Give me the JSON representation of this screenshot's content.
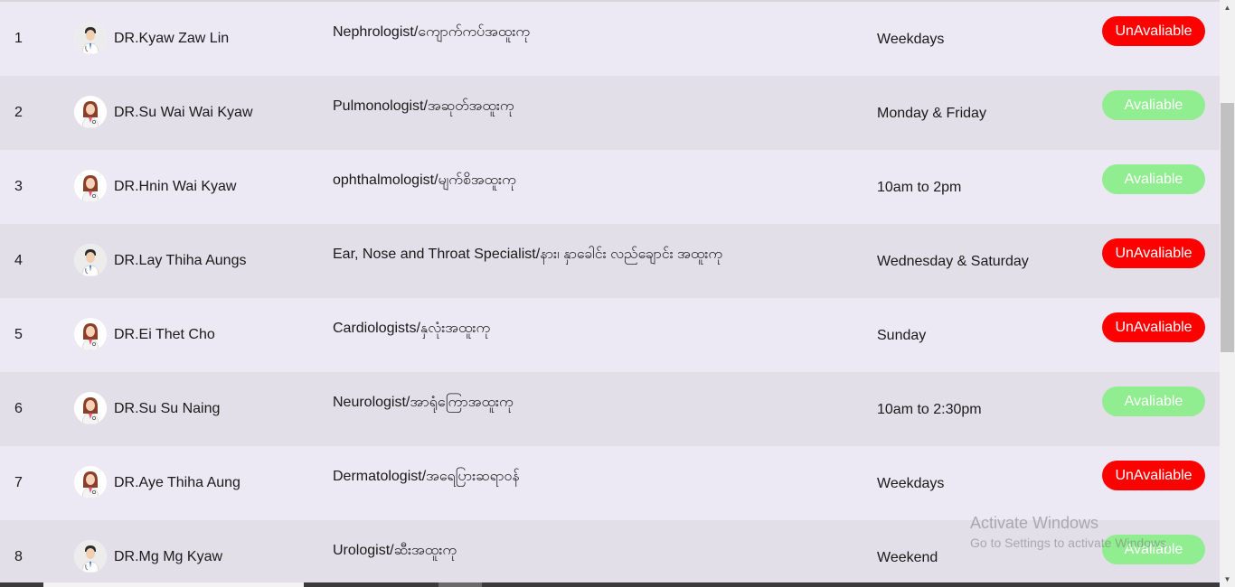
{
  "doctors": [
    {
      "number": "1",
      "name": "DR.Kyaw Zaw Lin",
      "gender": "male",
      "specialty": "Nephrologist/ကျောက်ကပ်အထူးကု",
      "schedule": "Weekdays",
      "status": "UnAvaliable",
      "status_type": "unavailable"
    },
    {
      "number": "2",
      "name": "DR.Su Wai Wai Kyaw",
      "gender": "female",
      "specialty": "Pulmonologist/အဆုတ်အထူးကု",
      "schedule": "Monday & Friday",
      "status": "Avaliable",
      "status_type": "available"
    },
    {
      "number": "3",
      "name": "DR.Hnin Wai Kyaw",
      "gender": "female",
      "specialty": "ophthalmologist/မျက်စိအထူးကု",
      "schedule": "10am to 2pm",
      "status": "Avaliable",
      "status_type": "available"
    },
    {
      "number": "4",
      "name": "DR.Lay Thiha Aungs",
      "gender": "male",
      "specialty": "Ear, Nose and Throat Specialist/နား၊ နှာခေါင်း လည်ချောင်း အထူးကု",
      "schedule": "Wednesday & Saturday",
      "status": "UnAvaliable",
      "status_type": "unavailable"
    },
    {
      "number": "5",
      "name": "DR.Ei Thet Cho",
      "gender": "female",
      "specialty": "Cardiologists/နှလုံးအထူးကု",
      "schedule": "Sunday",
      "status": "UnAvaliable",
      "status_type": "unavailable"
    },
    {
      "number": "6",
      "name": "DR.Su Su Naing",
      "gender": "female",
      "specialty": "Neurologist/အာရုံကြောအထူးကု",
      "schedule": "10am to 2:30pm",
      "status": "Avaliable",
      "status_type": "available"
    },
    {
      "number": "7",
      "name": "DR.Aye Thiha Aung",
      "gender": "female",
      "specialty": "Dermatologist/အရေပြားဆရာဝန်",
      "schedule": "Weekdays",
      "status": "UnAvaliable",
      "status_type": "unavailable"
    },
    {
      "number": "8",
      "name": "DR.Mg Mg Kyaw",
      "gender": "male",
      "specialty": "Urologist/ဆီးအထူးကု",
      "schedule": "Weekend",
      "status": "Avaliable",
      "status_type": "available"
    }
  ],
  "colors": {
    "unavailable": "#ff0000",
    "available": "#90ee90",
    "row_odd": "#ece8f4",
    "row_even": "#e3dfe9"
  },
  "watermark": {
    "title": "Activate Windows",
    "subtitle": "Go to Settings to activate Windows."
  },
  "icons": {
    "male_avatar": "male-doctor-icon",
    "female_avatar": "female-doctor-icon",
    "scroll_up": "chevron-up-icon",
    "scroll_down": "chevron-down-icon"
  }
}
